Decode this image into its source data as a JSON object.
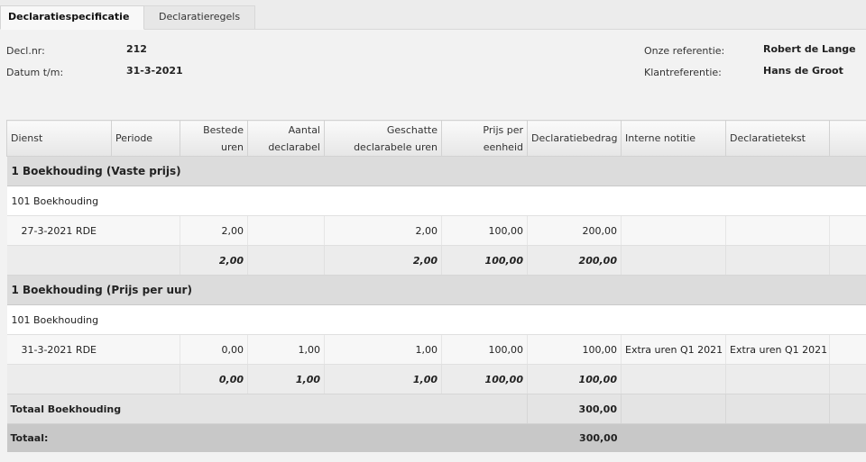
{
  "tabs": [
    {
      "label": "Declaratiespecificatie",
      "active": true
    },
    {
      "label": "Declaratieregels",
      "active": false
    }
  ],
  "header": {
    "decl_nr_label": "Decl.nr:",
    "decl_nr_value": "212",
    "datum_label": "Datum t/m:",
    "datum_value": "31-3-2021",
    "onze_ref_label": "Onze referentie:",
    "onze_ref_value": "Robert de Lange",
    "klant_ref_label": "Klantreferentie:",
    "klant_ref_value": "Hans de Groot"
  },
  "columns": {
    "dienst": "Dienst",
    "periode": "Periode",
    "bestede_1": "Bestede",
    "bestede_2": "uren",
    "aantal_1": "Aantal",
    "aantal_2": "declarabel",
    "geschatte_1": "Geschatte",
    "geschatte_2": "declarabele uren",
    "prijs_1": "Prijs per",
    "prijs_2": "eenheid",
    "declaratiebedrag": "Declaratiebedrag",
    "interne_notitie": "Interne notitie",
    "declaratietekst": "Declaratietekst"
  },
  "group1": {
    "title": "1 Boekhouding (Vaste prijs)",
    "sub": "101 Boekhouding",
    "line": {
      "periode": "27-3-2021 RDE",
      "bestede": "2,00",
      "aantal": "",
      "geschatte": "2,00",
      "prijs": "100,00",
      "bedrag": "200,00",
      "notitie": "",
      "tekst": ""
    },
    "sum": {
      "bestede": "2,00",
      "aantal": "",
      "geschatte": "2,00",
      "prijs": "100,00",
      "bedrag": "200,00"
    }
  },
  "group2": {
    "title": "1 Boekhouding (Prijs per uur)",
    "sub": "101 Boekhouding",
    "line": {
      "periode": "31-3-2021 RDE",
      "bestede": "0,00",
      "aantal": "1,00",
      "geschatte": "1,00",
      "prijs": "100,00",
      "bedrag": "100,00",
      "notitie": "Extra uren Q1 2021",
      "tekst": "Extra uren Q1 2021"
    },
    "sum": {
      "bestede": "0,00",
      "aantal": "1,00",
      "geschatte": "1,00",
      "prijs": "100,00",
      "bedrag": "100,00"
    }
  },
  "totaal_boekhouding": {
    "label": "Totaal Boekhouding",
    "bedrag": "300,00"
  },
  "totaal": {
    "label": "Totaal:",
    "bedrag": "300,00"
  }
}
